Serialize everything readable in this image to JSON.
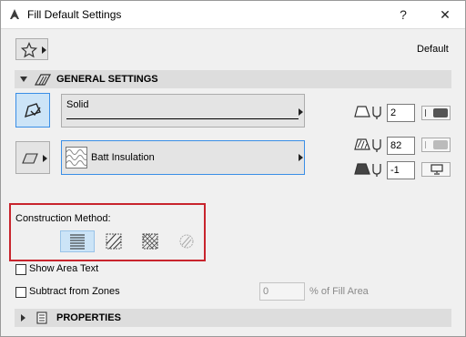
{
  "window": {
    "title": "Fill Default Settings",
    "help": "?",
    "close": "✕"
  },
  "favorites": {
    "preset_label": "Default"
  },
  "general": {
    "section_title": "GENERAL SETTINGS",
    "fill_type": "Solid",
    "fill_pattern": "Batt Insulation",
    "pen_value": "2",
    "pattern_pen_value": "82",
    "background_pen_value": "-1"
  },
  "construction": {
    "label": "Construction Method:",
    "selected_index": 0
  },
  "options": {
    "show_area_text": "Show Area Text",
    "subtract_from_zones": "Subtract from Zones",
    "percent_value": "0",
    "percent_suffix": "% of Fill Area"
  },
  "properties": {
    "section_title": "PROPERTIES"
  }
}
